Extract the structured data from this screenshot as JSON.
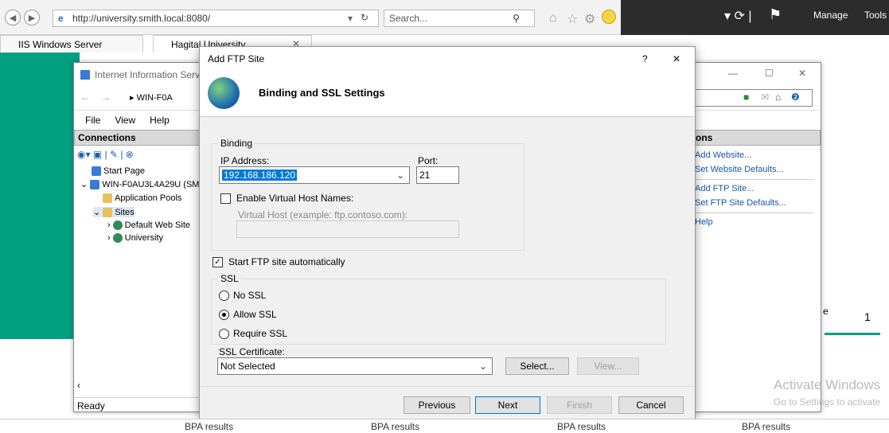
{
  "browser": {
    "url": "http://university.smith.local:8080/",
    "search_placeholder": "Search...",
    "tabs": [
      {
        "label": "IIS Windows Server"
      },
      {
        "label": "Hagital University"
      }
    ]
  },
  "server_manager": {
    "manage_label": "Manage",
    "tools_label": "Tools",
    "tile_number": "1",
    "tile_partial": "e"
  },
  "iis": {
    "title": "Internet Information Servic",
    "nav_path": "WIN-F0A",
    "menu": [
      "File",
      "View",
      "Help"
    ],
    "connections_header": "Connections",
    "tree": [
      {
        "label": "Start Page"
      },
      {
        "label": "WIN-F0AU3L4A29U (SM"
      },
      {
        "label": "Application Pools"
      },
      {
        "label": "Sites"
      },
      {
        "label": "Default Web Site"
      },
      {
        "label": "University"
      }
    ],
    "actions_header": "ons",
    "actions": [
      "Add Website...",
      "Set Website Defaults...",
      "Add FTP Site...",
      "Set FTP Site Defaults...",
      "Help"
    ],
    "status": "Ready"
  },
  "dialog": {
    "title": "Add FTP Site",
    "help": "?",
    "close": "✕",
    "heading": "Binding and SSL Settings",
    "binding_legend": "Binding",
    "ip_label": "IP Address:",
    "ip_value": "192.168.186.120",
    "port_label": "Port:",
    "port_value": "21",
    "vhost_checkbox": "Enable Virtual Host Names:",
    "vhost_label": "Virtual Host (example: ftp.contoso.com):",
    "autostart_checkbox": "Start FTP site automatically",
    "ssl_legend": "SSL",
    "ssl_options": [
      "No SSL",
      "Allow SSL",
      "Require SSL"
    ],
    "ssl_selected": "Allow SSL",
    "cert_label": "SSL Certificate:",
    "cert_value": "Not Selected",
    "select_btn": "Select...",
    "view_btn": "View...",
    "previous_btn": "Previous",
    "next_btn": "Next",
    "finish_btn": "Finish",
    "cancel_btn": "Cancel"
  },
  "bpa": [
    "BPA results",
    "BPA results",
    "BPA results",
    "BPA results"
  ],
  "watermark": {
    "line1": "Activate Windows",
    "line2": "Go to Settings to activate"
  },
  "colors": {
    "accent": "#0078d7",
    "green": "#00a080",
    "link": "#1a56a8"
  }
}
